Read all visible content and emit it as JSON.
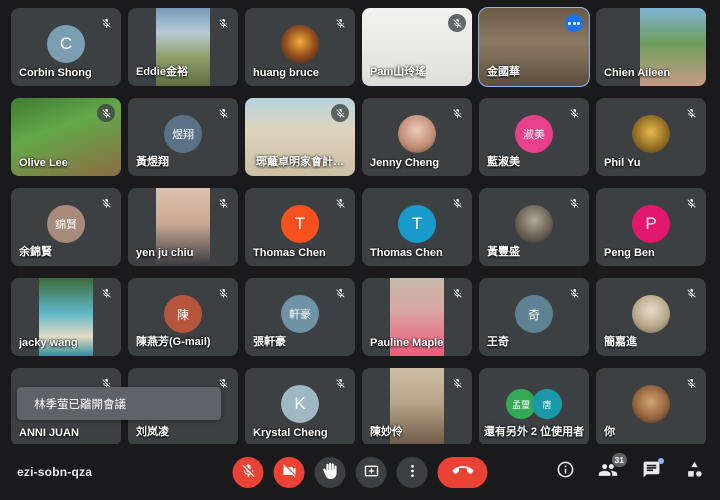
{
  "meeting": {
    "code": "ezi-sobn-qza",
    "toast": "林季萤已離開會議",
    "participant_count": "31"
  },
  "colors": {
    "background": "#1a1a1c",
    "tile": "#3c4043",
    "active_border": "#8ab4f8",
    "danger": "#ea4335",
    "accent_blue": "#1a73e8"
  },
  "tiles": [
    {
      "name": "Corbin Shong",
      "initial": "C",
      "avatar_color": "#7b9eb3",
      "kind": "avatar",
      "muted": true,
      "active": false,
      "name_align": "left"
    },
    {
      "name": "Eddie金裕",
      "initial": "",
      "avatar_color": "",
      "kind": "video",
      "muted": true,
      "active": false,
      "name_align": "left"
    },
    {
      "name": "huang bruce",
      "initial": "",
      "avatar_color": "#6b4a2f",
      "kind": "photo",
      "muted": true,
      "active": false,
      "name_align": "left"
    },
    {
      "name": "Pam山玲瑤",
      "initial": "",
      "avatar_color": "",
      "kind": "video",
      "muted": true,
      "active": false,
      "name_align": "left"
    },
    {
      "name": "金國華",
      "initial": "",
      "avatar_color": "",
      "kind": "video",
      "muted": false,
      "active": true,
      "name_align": "left"
    },
    {
      "name": "Chien Aileen",
      "initial": "",
      "avatar_color": "",
      "kind": "video",
      "muted": false,
      "active": false,
      "name_align": "left"
    },
    {
      "name": "Olive Lee",
      "initial": "",
      "avatar_color": "",
      "kind": "video",
      "muted": true,
      "active": false,
      "name_align": "left"
    },
    {
      "name": "黃煜翔",
      "initial": "煜翔",
      "avatar_color": "#5b7186",
      "kind": "avatar",
      "muted": true,
      "active": false,
      "name_align": "left"
    },
    {
      "name": "琊蘺卓明家會計…",
      "initial": "",
      "avatar_color": "",
      "kind": "video",
      "muted": true,
      "active": false,
      "name_align": "center"
    },
    {
      "name": "Jenny Cheng",
      "initial": "",
      "avatar_color": "#c8a090",
      "kind": "photo",
      "muted": true,
      "active": false,
      "name_align": "left"
    },
    {
      "name": "藍淑美",
      "initial": "淑美",
      "avatar_color": "#e8408a",
      "kind": "avatar",
      "muted": true,
      "active": false,
      "name_align": "left"
    },
    {
      "name": "Phil Yu",
      "initial": "",
      "avatar_color": "#8a6b2a",
      "kind": "photo",
      "muted": true,
      "active": false,
      "name_align": "left"
    },
    {
      "name": "余錦賢",
      "initial": "錦賢",
      "avatar_color": "#a98b7c",
      "kind": "avatar",
      "muted": true,
      "active": false,
      "name_align": "left"
    },
    {
      "name": "yen ju chiu",
      "initial": "",
      "avatar_color": "",
      "kind": "video",
      "muted": true,
      "active": false,
      "name_align": "left"
    },
    {
      "name": "Thomas Chen",
      "initial": "T",
      "avatar_color": "#f4511e",
      "kind": "avatar",
      "muted": true,
      "active": false,
      "name_align": "left"
    },
    {
      "name": "Thomas Chen",
      "initial": "T",
      "avatar_color": "#1a9aca",
      "kind": "avatar",
      "muted": true,
      "active": false,
      "name_align": "left"
    },
    {
      "name": "黃豐盛",
      "initial": "",
      "avatar_color": "#6d6257",
      "kind": "photo",
      "muted": true,
      "active": false,
      "name_align": "left"
    },
    {
      "name": "Peng Ben",
      "initial": "P",
      "avatar_color": "#e3176b",
      "kind": "avatar",
      "muted": true,
      "active": false,
      "name_align": "left"
    },
    {
      "name": "jacky wang",
      "initial": "",
      "avatar_color": "",
      "kind": "video",
      "muted": true,
      "active": false,
      "name_align": "left"
    },
    {
      "name": "陳燕芳(G-mail)",
      "initial": "陳",
      "avatar_color": "#b5563c",
      "kind": "avatar",
      "muted": true,
      "active": false,
      "name_align": "left"
    },
    {
      "name": "張軒豪",
      "initial": "軒豪",
      "avatar_color": "#6f93a5",
      "kind": "avatar",
      "muted": true,
      "active": false,
      "name_align": "left"
    },
    {
      "name": "Pauline Maple",
      "initial": "",
      "avatar_color": "",
      "kind": "video",
      "muted": true,
      "active": false,
      "name_align": "left"
    },
    {
      "name": "王奇",
      "initial": "奇",
      "avatar_color": "#5f8194",
      "kind": "avatar",
      "muted": true,
      "active": false,
      "name_align": "left"
    },
    {
      "name": "簡嘉進",
      "initial": "",
      "avatar_color": "#c9b79d",
      "kind": "photo",
      "muted": true,
      "active": false,
      "name_align": "left"
    },
    {
      "name": "ANNI JUAN",
      "initial": "",
      "avatar_color": "",
      "kind": "blank",
      "muted": true,
      "active": false,
      "name_align": "left"
    },
    {
      "name": "刘岚凌",
      "initial": "",
      "avatar_color": "",
      "kind": "blank",
      "muted": true,
      "active": false,
      "name_align": "left"
    },
    {
      "name": "Krystal Cheng",
      "initial": "K",
      "avatar_color": "#9fb8c4",
      "kind": "avatar",
      "muted": true,
      "active": false,
      "name_align": "left"
    },
    {
      "name": "陳妙伶",
      "initial": "",
      "avatar_color": "",
      "kind": "video",
      "muted": true,
      "active": false,
      "name_align": "left"
    },
    {
      "name": "還有另外 2 位使用者",
      "initial": "",
      "avatar_color": "",
      "kind": "overflow",
      "muted": false,
      "active": false,
      "name_align": "center",
      "overflow_initials": [
        "孟璽",
        "唐"
      ]
    },
    {
      "name": "你",
      "initial": "",
      "avatar_color": "#6d5442",
      "kind": "photo",
      "muted": true,
      "active": false,
      "name_align": "left"
    }
  ],
  "controls": {
    "center": [
      {
        "label": "關閉麥克風",
        "icon": "mic-off-icon",
        "style": "red"
      },
      {
        "label": "關閉攝影機",
        "icon": "camera-off-icon",
        "style": "red"
      },
      {
        "label": "舉手",
        "icon": "raise-hand-icon",
        "style": "grey"
      },
      {
        "label": "立即分享螢幕畫面",
        "icon": "present-screen-icon",
        "style": "grey"
      },
      {
        "label": "更多選項",
        "icon": "more-vert-icon",
        "style": "grey"
      },
      {
        "label": "離開通話",
        "icon": "hangup-icon",
        "style": "hangup"
      }
    ],
    "right": [
      {
        "label": "會議詳細資料",
        "icon": "info-icon",
        "badge": ""
      },
      {
        "label": "顯示所有參與者",
        "icon": "people-icon",
        "badge": "31"
      },
      {
        "label": "與所有人進行即時通訊",
        "icon": "chat-icon",
        "badge": "dot"
      },
      {
        "label": "活動",
        "icon": "activities-icon",
        "badge": ""
      }
    ]
  }
}
